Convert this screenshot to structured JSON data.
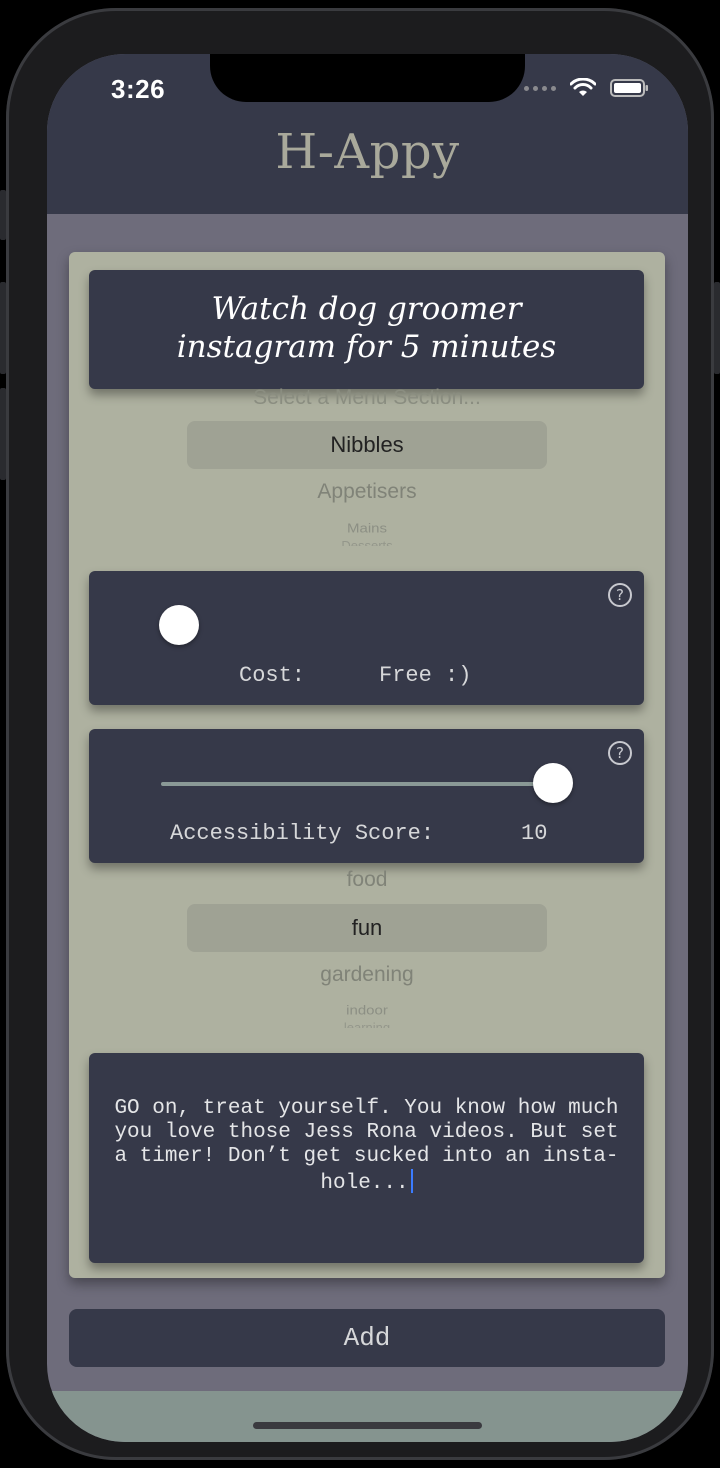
{
  "status_bar": {
    "time": "3:26"
  },
  "app": {
    "title": "H-Appy"
  },
  "activity": {
    "title_line1": "Watch dog groomer",
    "title_line2": "instagram for 5 minutes"
  },
  "menu_picker": {
    "placeholder": "Select a Menu Section...",
    "selected": "Nibbles",
    "below": [
      "Appetisers",
      "Mains",
      "Desserts"
    ]
  },
  "cost": {
    "label": "Cost:",
    "value": "Free :)",
    "slider_fraction": 0.0
  },
  "accessibility": {
    "label": "Accessibility Score:",
    "value": "10",
    "slider_fraction": 1.0
  },
  "category_picker": {
    "above": "food",
    "selected": "fun",
    "below": [
      "gardening",
      "indoor",
      "learning"
    ]
  },
  "description": {
    "text": "GO on, treat yourself. You know how much you love those Jess Rona videos. But set a timer! Don’t get sucked into an insta-hole..."
  },
  "actions": {
    "add_label": "Add"
  },
  "icons": {
    "help": "help-icon",
    "wifi": "wifi-icon",
    "battery": "battery-icon"
  },
  "colors": {
    "header": "#363949",
    "card": "#aeb1a0",
    "panel": "#363949",
    "background": "#6e6c7b",
    "caret": "#3b7bff"
  }
}
